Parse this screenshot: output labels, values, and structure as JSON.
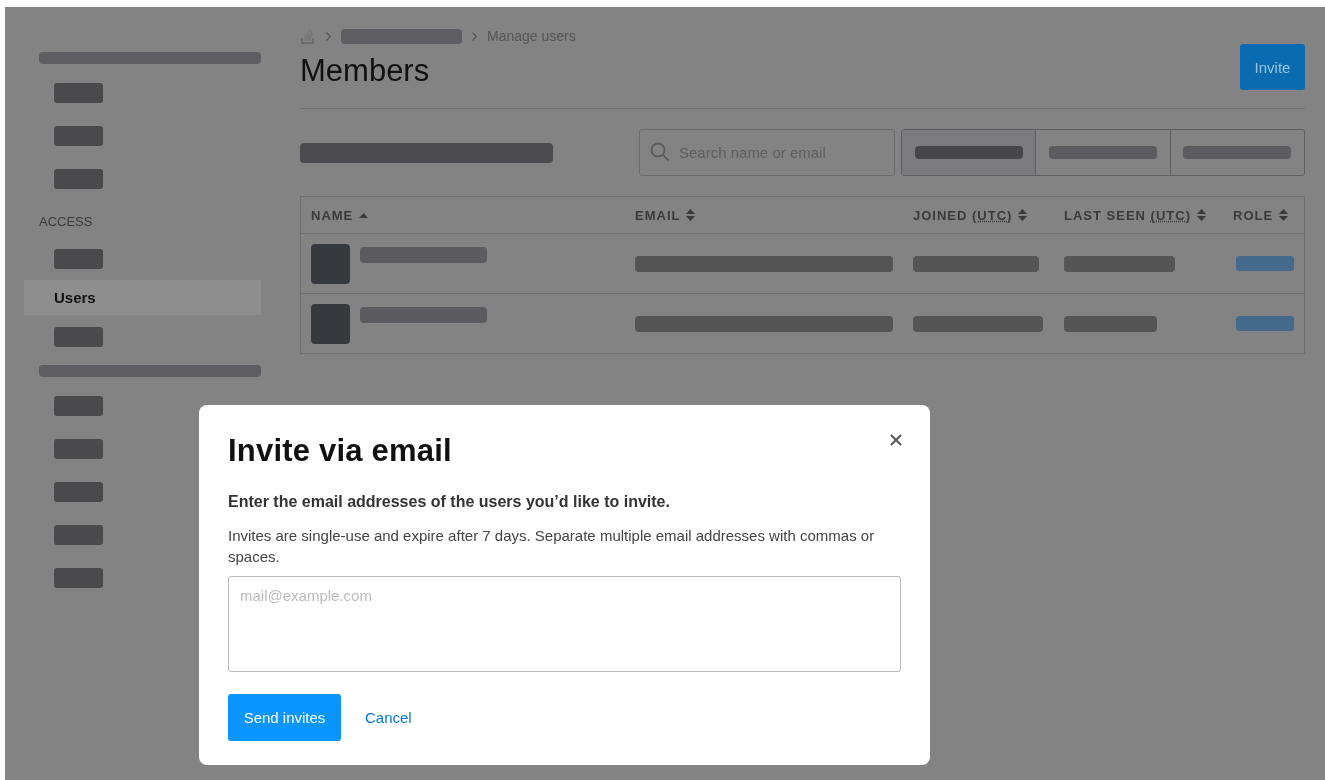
{
  "sidebar": {
    "items": [
      {
        "kind": "redacted-heading"
      },
      {
        "kind": "redacted"
      },
      {
        "kind": "redacted"
      },
      {
        "kind": "redacted"
      },
      {
        "kind": "heading",
        "label": "ACCESS"
      },
      {
        "kind": "redacted"
      },
      {
        "kind": "link",
        "label": "Users",
        "selected": true
      },
      {
        "kind": "redacted"
      },
      {
        "kind": "redacted-heading"
      },
      {
        "kind": "redacted"
      },
      {
        "kind": "redacted"
      },
      {
        "kind": "redacted"
      },
      {
        "kind": "redacted"
      },
      {
        "kind": "redacted"
      }
    ]
  },
  "breadcrumb": {
    "current": "Manage users"
  },
  "page_title": "Members",
  "invite_button": "Invite",
  "search": {
    "placeholder": "Search name or email"
  },
  "filter_segments": [
    {
      "selected": true
    },
    {
      "selected": false
    },
    {
      "selected": false
    }
  ],
  "table": {
    "columns": [
      {
        "label": "NAME",
        "sorted_ascending": true
      },
      {
        "label": "EMAIL",
        "sorted_ascending": false
      },
      {
        "label": "JOINED",
        "abbr": "(UTC)",
        "sorted_ascending": false
      },
      {
        "label": "LAST SEEN",
        "abbr": "(UTC)",
        "sorted_ascending": false
      },
      {
        "label": "ROLE",
        "sorted_ascending": false
      }
    ],
    "rows": [
      {
        "kind": "redacted"
      },
      {
        "kind": "redacted"
      }
    ]
  },
  "dialog": {
    "title": "Invite via email",
    "subtitle": "Enter the email addresses of the users you’d like to invite.",
    "description": "Invites are single-use and expire after 7 days. Separate multiple email addresses with commas or spaces.",
    "field": {
      "placeholder": "mail@example.com"
    },
    "primary_button": "Send invites",
    "cancel_link": "Cancel"
  }
}
